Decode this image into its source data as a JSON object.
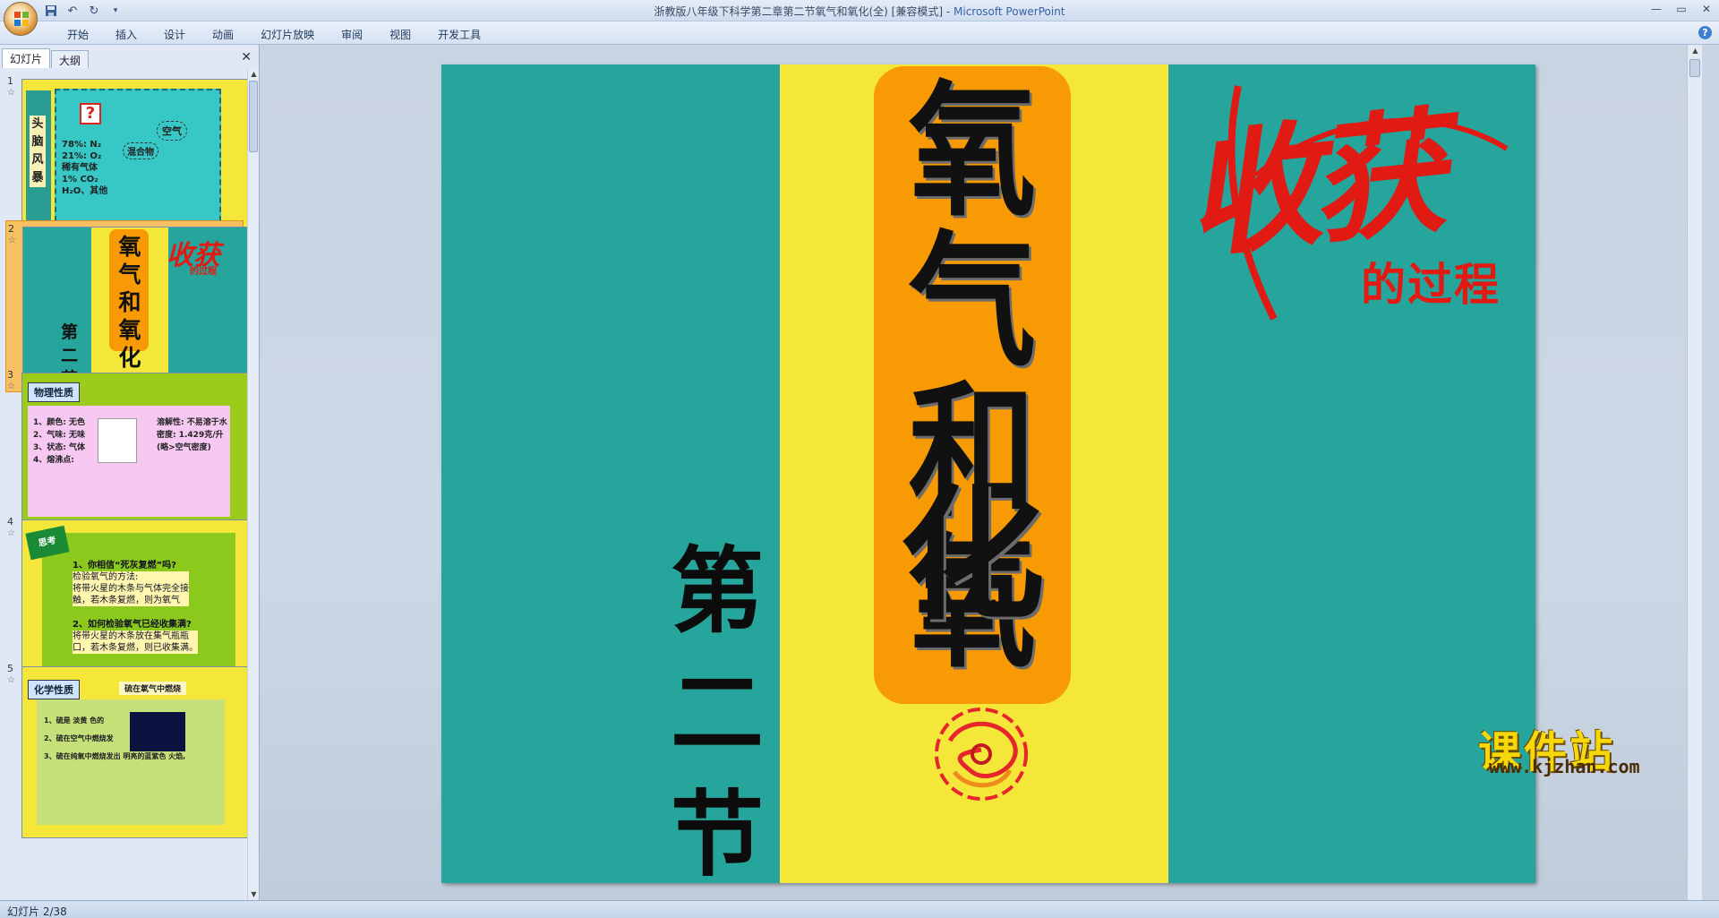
{
  "window": {
    "title": "浙教版八年级下科学第二章第二节氧气和氧化(全) [兼容模式] - ",
    "app_name": "Microsoft PowerPoint"
  },
  "quick_access": [
    "save-icon",
    "undo-icon",
    "redo-icon",
    "customize-icon"
  ],
  "ribbon": {
    "tabs": [
      "开始",
      "插入",
      "设计",
      "动画",
      "幻灯片放映",
      "审阅",
      "视图",
      "开发工具"
    ]
  },
  "left_pane": {
    "tabs": [
      "幻灯片",
      "大纲"
    ],
    "active_tab": "幻灯片",
    "selected_slide": 2,
    "thumbnails": [
      {
        "number": "1",
        "label": "头脑风暴",
        "lines": [
          "78%: N₂",
          "21%: O₂",
          "稀有气体",
          "1%   CO₂",
          "H₂O、其他"
        ],
        "side_labels": [
          "空气",
          "混合物"
        ]
      },
      {
        "number": "2",
        "title": "氧气和氧化",
        "section": "第二节",
        "harvest": "收获",
        "harvest_sub": "的过程"
      },
      {
        "number": "3",
        "header": "物理性质",
        "items": [
          "1、颜色: 无色",
          "2、气味: 无味",
          "3、状态: 气体",
          "4、熔沸点:"
        ],
        "right": [
          "溶解性: 不易溶于水",
          "密度: 1.429克/升",
          "(略>空气密度)"
        ]
      },
      {
        "number": "4",
        "badge": "思考",
        "q1": "1、你相信“死灰复燃”吗?",
        "a1": [
          "检验氧气的方法:",
          "将带火星的木条与气体完全接",
          "触，若木条复燃，则为氧气"
        ],
        "q2": "2、如何检验氧气已经收集满?",
        "a2": [
          "将带火星的木条放在集气瓶瓶",
          "口，若木条复燃，则已收集满。"
        ]
      },
      {
        "number": "5",
        "header": "化学性质",
        "sub": "硫在氧气中燃烧",
        "items": [
          "1、硫是 淡黄 色的",
          "2、硫在空气中燃烧发",
          "3、硫在纯氧中燃烧发出 明亮的蓝紫色 火焰,"
        ]
      }
    ]
  },
  "slide": {
    "title_chars": [
      "氧",
      "气",
      "和",
      "氧",
      "化"
    ],
    "section_chars": [
      "第",
      "二",
      "节"
    ],
    "harvest": "收获",
    "harvest_sub": "的过程",
    "colors": {
      "teal": "#26a59c",
      "yellow": "#f5e63a",
      "orange": "#f79a04",
      "red": "#e11a14"
    }
  },
  "watermark": {
    "text": "课件站",
    "url": "www.kjzhan.com"
  },
  "status": {
    "slide_info": "幻灯片 2/38"
  }
}
